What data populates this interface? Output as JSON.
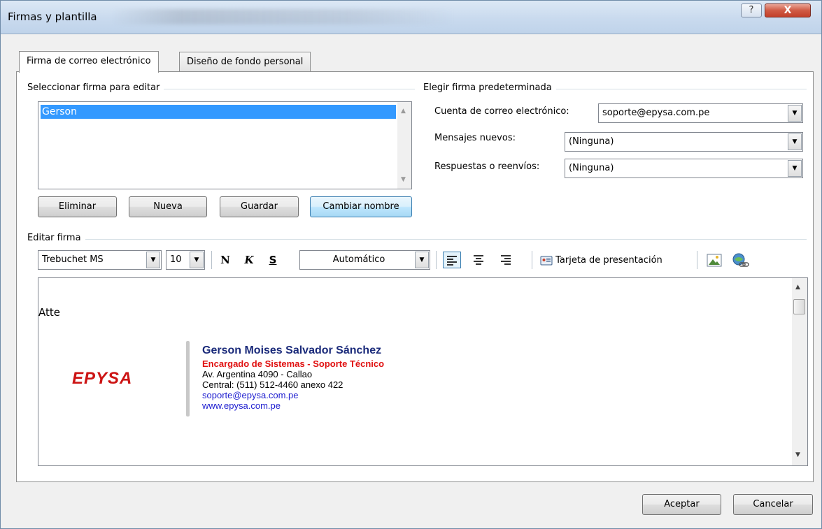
{
  "window": {
    "title": "Firmas y plantilla",
    "help_glyph": "?",
    "close_glyph": "X"
  },
  "tabs": [
    {
      "label": "Firma de correo electrónico",
      "active": true
    },
    {
      "label": "Diseño de fondo personal",
      "active": false
    }
  ],
  "select_section": {
    "label": "Seleccionar firma para editar",
    "items": [
      "Gerson"
    ],
    "selected": "Gerson"
  },
  "buttons": {
    "delete": "Eliminar",
    "new": "Nueva",
    "save": "Guardar",
    "rename": "Cambiar nombre"
  },
  "default_section": {
    "label": "Elegir firma predeterminada",
    "account_label": "Cuenta de correo electrónico:",
    "account_value": "soporte@epysa.com.pe",
    "new_messages_label": "Mensajes nuevos:",
    "new_messages_value": "(Ninguna)",
    "replies_label": "Respuestas o reenvíos:",
    "replies_value": "(Ninguna)"
  },
  "edit_section": {
    "label": "Editar firma",
    "font_name": "Trebuchet MS",
    "font_size": "10",
    "bold": "N",
    "italic": "K",
    "underline": "S",
    "color": "Automático",
    "business_card": "Tarjeta de presentación"
  },
  "signature": {
    "greeting": "Atte",
    "logo_text": "EPYSA",
    "name": "Gerson Moises Salvador Sánchez",
    "role": "Encargado de Sistemas - Soporte Técnico",
    "address": "Av. Argentina 4090 - Callao",
    "phone": "Central: (511) 512-4460 anexo 422",
    "email": "soporte@epysa.com.pe",
    "web": "www.epysa.com.pe"
  },
  "footer": {
    "ok": "Aceptar",
    "cancel": "Cancelar"
  },
  "colors": {
    "selection": "#3399ff",
    "logo_red": "#cc1414",
    "name_blue": "#1a2a7a",
    "link_blue": "#2020d0"
  }
}
